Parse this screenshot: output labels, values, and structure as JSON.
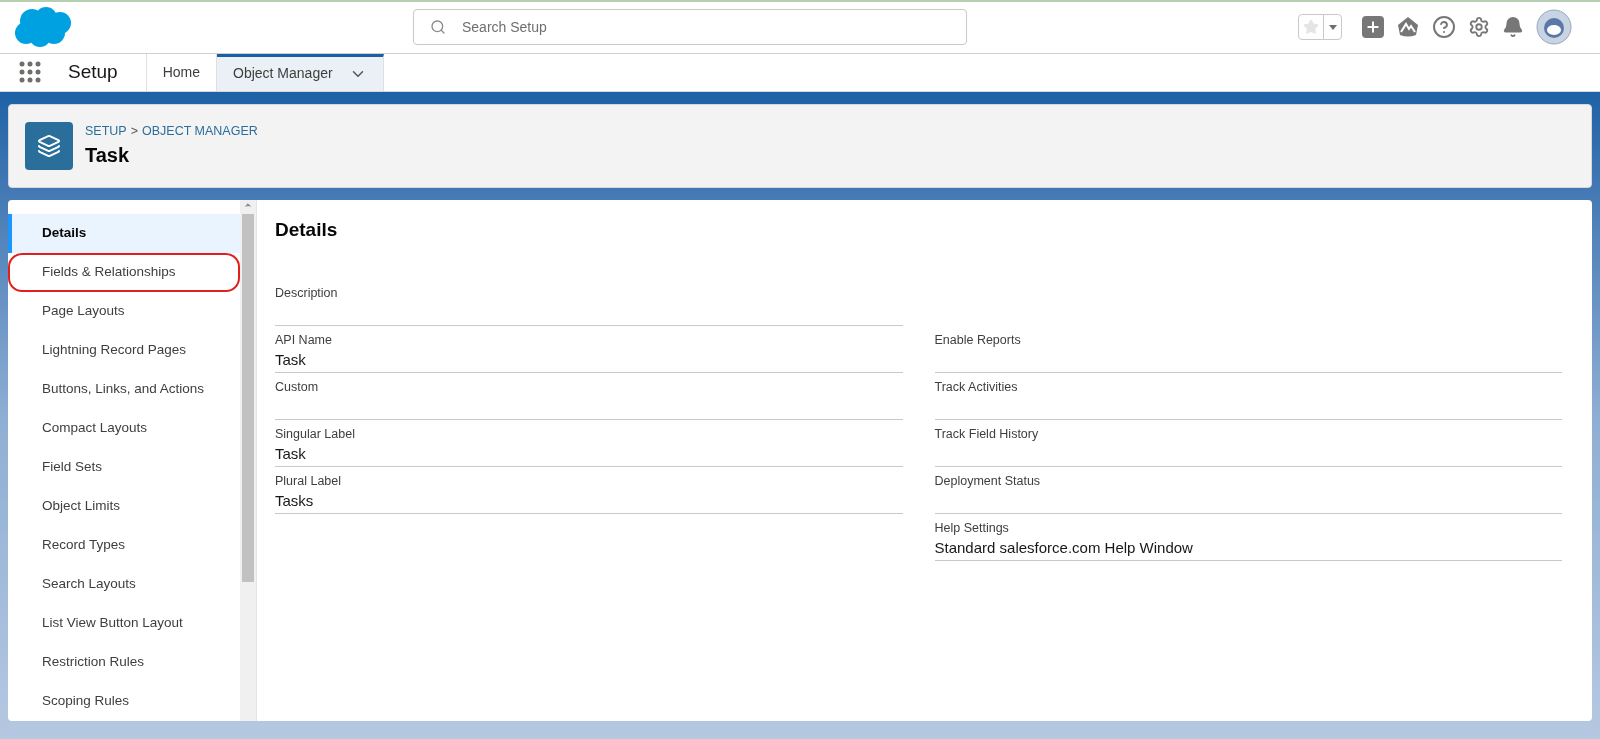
{
  "header": {
    "search": {
      "placeholder": "Search Setup"
    }
  },
  "nav": {
    "app_name": "Setup",
    "tabs": [
      {
        "label": "Home",
        "selected": false,
        "has_menu": false
      },
      {
        "label": "Object Manager",
        "selected": true,
        "has_menu": true
      }
    ]
  },
  "page_header": {
    "breadcrumb": [
      {
        "label": "SETUP"
      },
      {
        "label": "OBJECT MANAGER"
      }
    ],
    "separator": ">",
    "title": "Task"
  },
  "sidebar": {
    "items": [
      {
        "label": "Details",
        "selected": true,
        "circled": false
      },
      {
        "label": "Fields & Relationships",
        "selected": false,
        "circled": true
      },
      {
        "label": "Page Layouts",
        "selected": false,
        "circled": false
      },
      {
        "label": "Lightning Record Pages",
        "selected": false,
        "circled": false
      },
      {
        "label": "Buttons, Links, and Actions",
        "selected": false,
        "circled": false
      },
      {
        "label": "Compact Layouts",
        "selected": false,
        "circled": false
      },
      {
        "label": "Field Sets",
        "selected": false,
        "circled": false
      },
      {
        "label": "Object Limits",
        "selected": false,
        "circled": false
      },
      {
        "label": "Record Types",
        "selected": false,
        "circled": false
      },
      {
        "label": "Search Layouts",
        "selected": false,
        "circled": false
      },
      {
        "label": "List View Button Layout",
        "selected": false,
        "circled": false
      },
      {
        "label": "Restriction Rules",
        "selected": false,
        "circled": false
      },
      {
        "label": "Scoping Rules",
        "selected": false,
        "circled": false
      }
    ]
  },
  "details": {
    "title": "Details",
    "rows": [
      {
        "left": {
          "label": "Description"
        }
      },
      {
        "left": {
          "label": "API Name",
          "value": "Task"
        },
        "right": {
          "label": "Enable Reports"
        }
      },
      {
        "left": {
          "label": "Custom"
        },
        "right": {
          "label": "Track Activities"
        }
      },
      {
        "left": {
          "label": "Singular Label",
          "value": "Task"
        },
        "right": {
          "label": "Track Field History"
        }
      },
      {
        "left": {
          "label": "Plural Label",
          "value": "Tasks"
        },
        "right": {
          "label": "Deployment Status"
        }
      },
      {
        "right": {
          "label": "Help Settings",
          "value": "Standard salesforce.com Help Window"
        }
      }
    ]
  }
}
